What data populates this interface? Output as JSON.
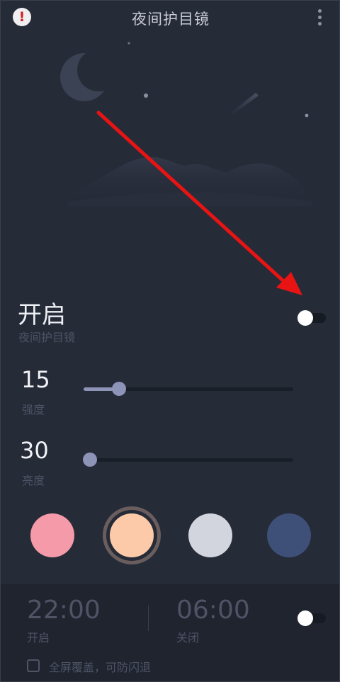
{
  "header": {
    "title": "夜间护目镜",
    "warning_icon": "exclamation-icon",
    "menu_icon": "more-vertical-icon"
  },
  "night_mode": {
    "label": "开启",
    "sublabel": "夜间护目镜",
    "enabled": false
  },
  "intensity": {
    "value": "15",
    "label": "强度",
    "fraction": 0.17
  },
  "brightness": {
    "value": "30",
    "label": "亮度",
    "fraction": 0.03
  },
  "colors": [
    {
      "name": "pink",
      "hex": "#f59aa8",
      "selected": false
    },
    {
      "name": "peach",
      "hex": "#fccaa8",
      "selected": true
    },
    {
      "name": "light-gray",
      "hex": "#d2d5de",
      "selected": false
    },
    {
      "name": "navy",
      "hex": "#3e5078",
      "selected": false
    }
  ],
  "schedule": {
    "start_time": "22:00",
    "start_label": "开启",
    "end_time": "06:00",
    "end_label": "关闭",
    "enabled": false,
    "fullscreen_label": "全屏覆盖，可防闪退",
    "fullscreen_checked": false
  },
  "annotation_color": "#e81414"
}
